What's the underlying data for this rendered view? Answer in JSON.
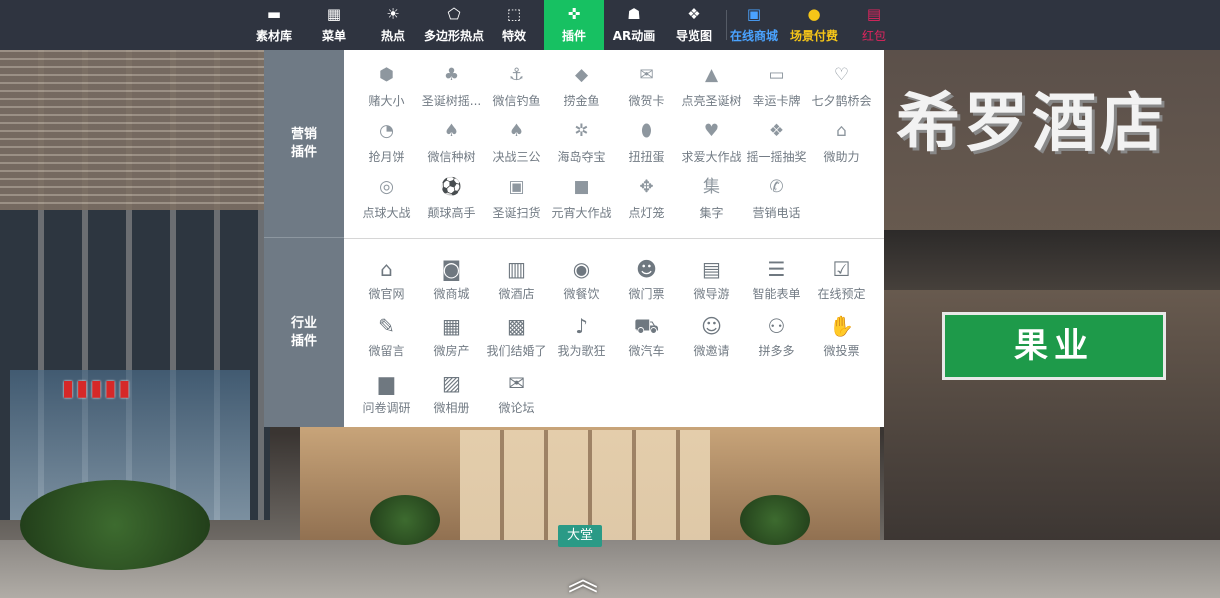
{
  "toolbar": {
    "items": [
      {
        "label": "素材库",
        "icon": "folder-icon"
      },
      {
        "label": "菜单",
        "icon": "grid-icon"
      },
      {
        "label": "热点",
        "icon": "sun-icon"
      },
      {
        "label": "多边形热点",
        "icon": "polygon-cursor-icon"
      },
      {
        "label": "特效",
        "icon": "sparkle-cursor-icon"
      },
      {
        "label": "插件",
        "icon": "plugin-icon",
        "active": true
      },
      {
        "label": "AR动画",
        "icon": "ar-icon"
      },
      {
        "label": "导览图",
        "icon": "map-book-icon"
      },
      {
        "label": "在线商城",
        "icon": "store-icon",
        "color": "#4aa3ff"
      },
      {
        "label": "场景付费",
        "icon": "coin-icon",
        "color": "#f5c518"
      },
      {
        "label": "红包",
        "icon": "red-envelope-icon",
        "color": "#e0245e"
      }
    ],
    "active_color": "#17c162"
  },
  "panel": {
    "marketing": {
      "label_line1": "营销",
      "label_line2": "插件",
      "items": [
        {
          "label": "赌大小",
          "icon": "dice-icon"
        },
        {
          "label": "圣诞树摇...",
          "icon": "xmas-tree-icon"
        },
        {
          "label": "微信钓鱼",
          "icon": "fishing-icon"
        },
        {
          "label": "捞金鱼",
          "icon": "fish-icon"
        },
        {
          "label": "微贺卡",
          "icon": "envelope-icon"
        },
        {
          "label": "点亮圣诞树",
          "icon": "tower-icon"
        },
        {
          "label": "幸运卡牌",
          "icon": "card-icon"
        },
        {
          "label": "七夕鹊桥会",
          "icon": "heartbeat-icon"
        },
        {
          "label": "抢月饼",
          "icon": "pie-icon"
        },
        {
          "label": "微信种树",
          "icon": "tree-icon"
        },
        {
          "label": "决战三公",
          "icon": "spade-icon"
        },
        {
          "label": "海岛夺宝",
          "icon": "palm-icon"
        },
        {
          "label": "扭扭蛋",
          "icon": "egg-icon"
        },
        {
          "label": "求爱大作战",
          "icon": "heart-pulse-icon"
        },
        {
          "label": "摇一摇抽奖",
          "icon": "handshake-icon"
        },
        {
          "label": "微助力",
          "icon": "home-heart-icon"
        },
        {
          "label": "点球大战",
          "icon": "soccer-outline-icon"
        },
        {
          "label": "颠球高手",
          "icon": "soccer-icon"
        },
        {
          "label": "圣诞扫货",
          "icon": "gift-icon"
        },
        {
          "label": "元宵大作战",
          "icon": "rounded-square-icon"
        },
        {
          "label": "点灯笼",
          "icon": "lantern-icon"
        },
        {
          "label": "集字",
          "icon": "ji-char-icon",
          "glyph": "集"
        },
        {
          "label": "营销电话",
          "icon": "phone-icon"
        }
      ]
    },
    "industry": {
      "label_line1": "行业",
      "label_line2": "插件",
      "items": [
        {
          "label": "微官网",
          "icon": "home-icon"
        },
        {
          "label": "微商城",
          "icon": "shopping-bag-icon"
        },
        {
          "label": "微酒店",
          "icon": "building-icon"
        },
        {
          "label": "微餐饮",
          "icon": "dining-icon"
        },
        {
          "label": "微门票",
          "icon": "person-ticket-icon"
        },
        {
          "label": "微导游",
          "icon": "id-card-icon"
        },
        {
          "label": "智能表单",
          "icon": "form-icon"
        },
        {
          "label": "在线预定",
          "icon": "calendar-check-icon"
        },
        {
          "label": "微留言",
          "icon": "edit-icon"
        },
        {
          "label": "微房产",
          "icon": "house-stack-icon"
        },
        {
          "label": "我们结婚了",
          "icon": "wedding-icon"
        },
        {
          "label": "我为歌狂",
          "icon": "microphone-icon"
        },
        {
          "label": "微汽车",
          "icon": "car-icon"
        },
        {
          "label": "微邀请",
          "icon": "invite-user-icon"
        },
        {
          "label": "拼多多",
          "icon": "group-icon"
        },
        {
          "label": "微投票",
          "icon": "thumbs-up-icon"
        },
        {
          "label": "问卷调研",
          "icon": "bar-chart-icon"
        },
        {
          "label": "微相册",
          "icon": "picture-icon"
        },
        {
          "label": "微论坛",
          "icon": "chat-bubbles-icon"
        }
      ]
    }
  },
  "scene": {
    "current_tag": "大堂",
    "expand_icon": "double-chevron-up-icon"
  },
  "background": {
    "hotel_sign": "希罗酒店",
    "fruit_sign": "果业"
  }
}
